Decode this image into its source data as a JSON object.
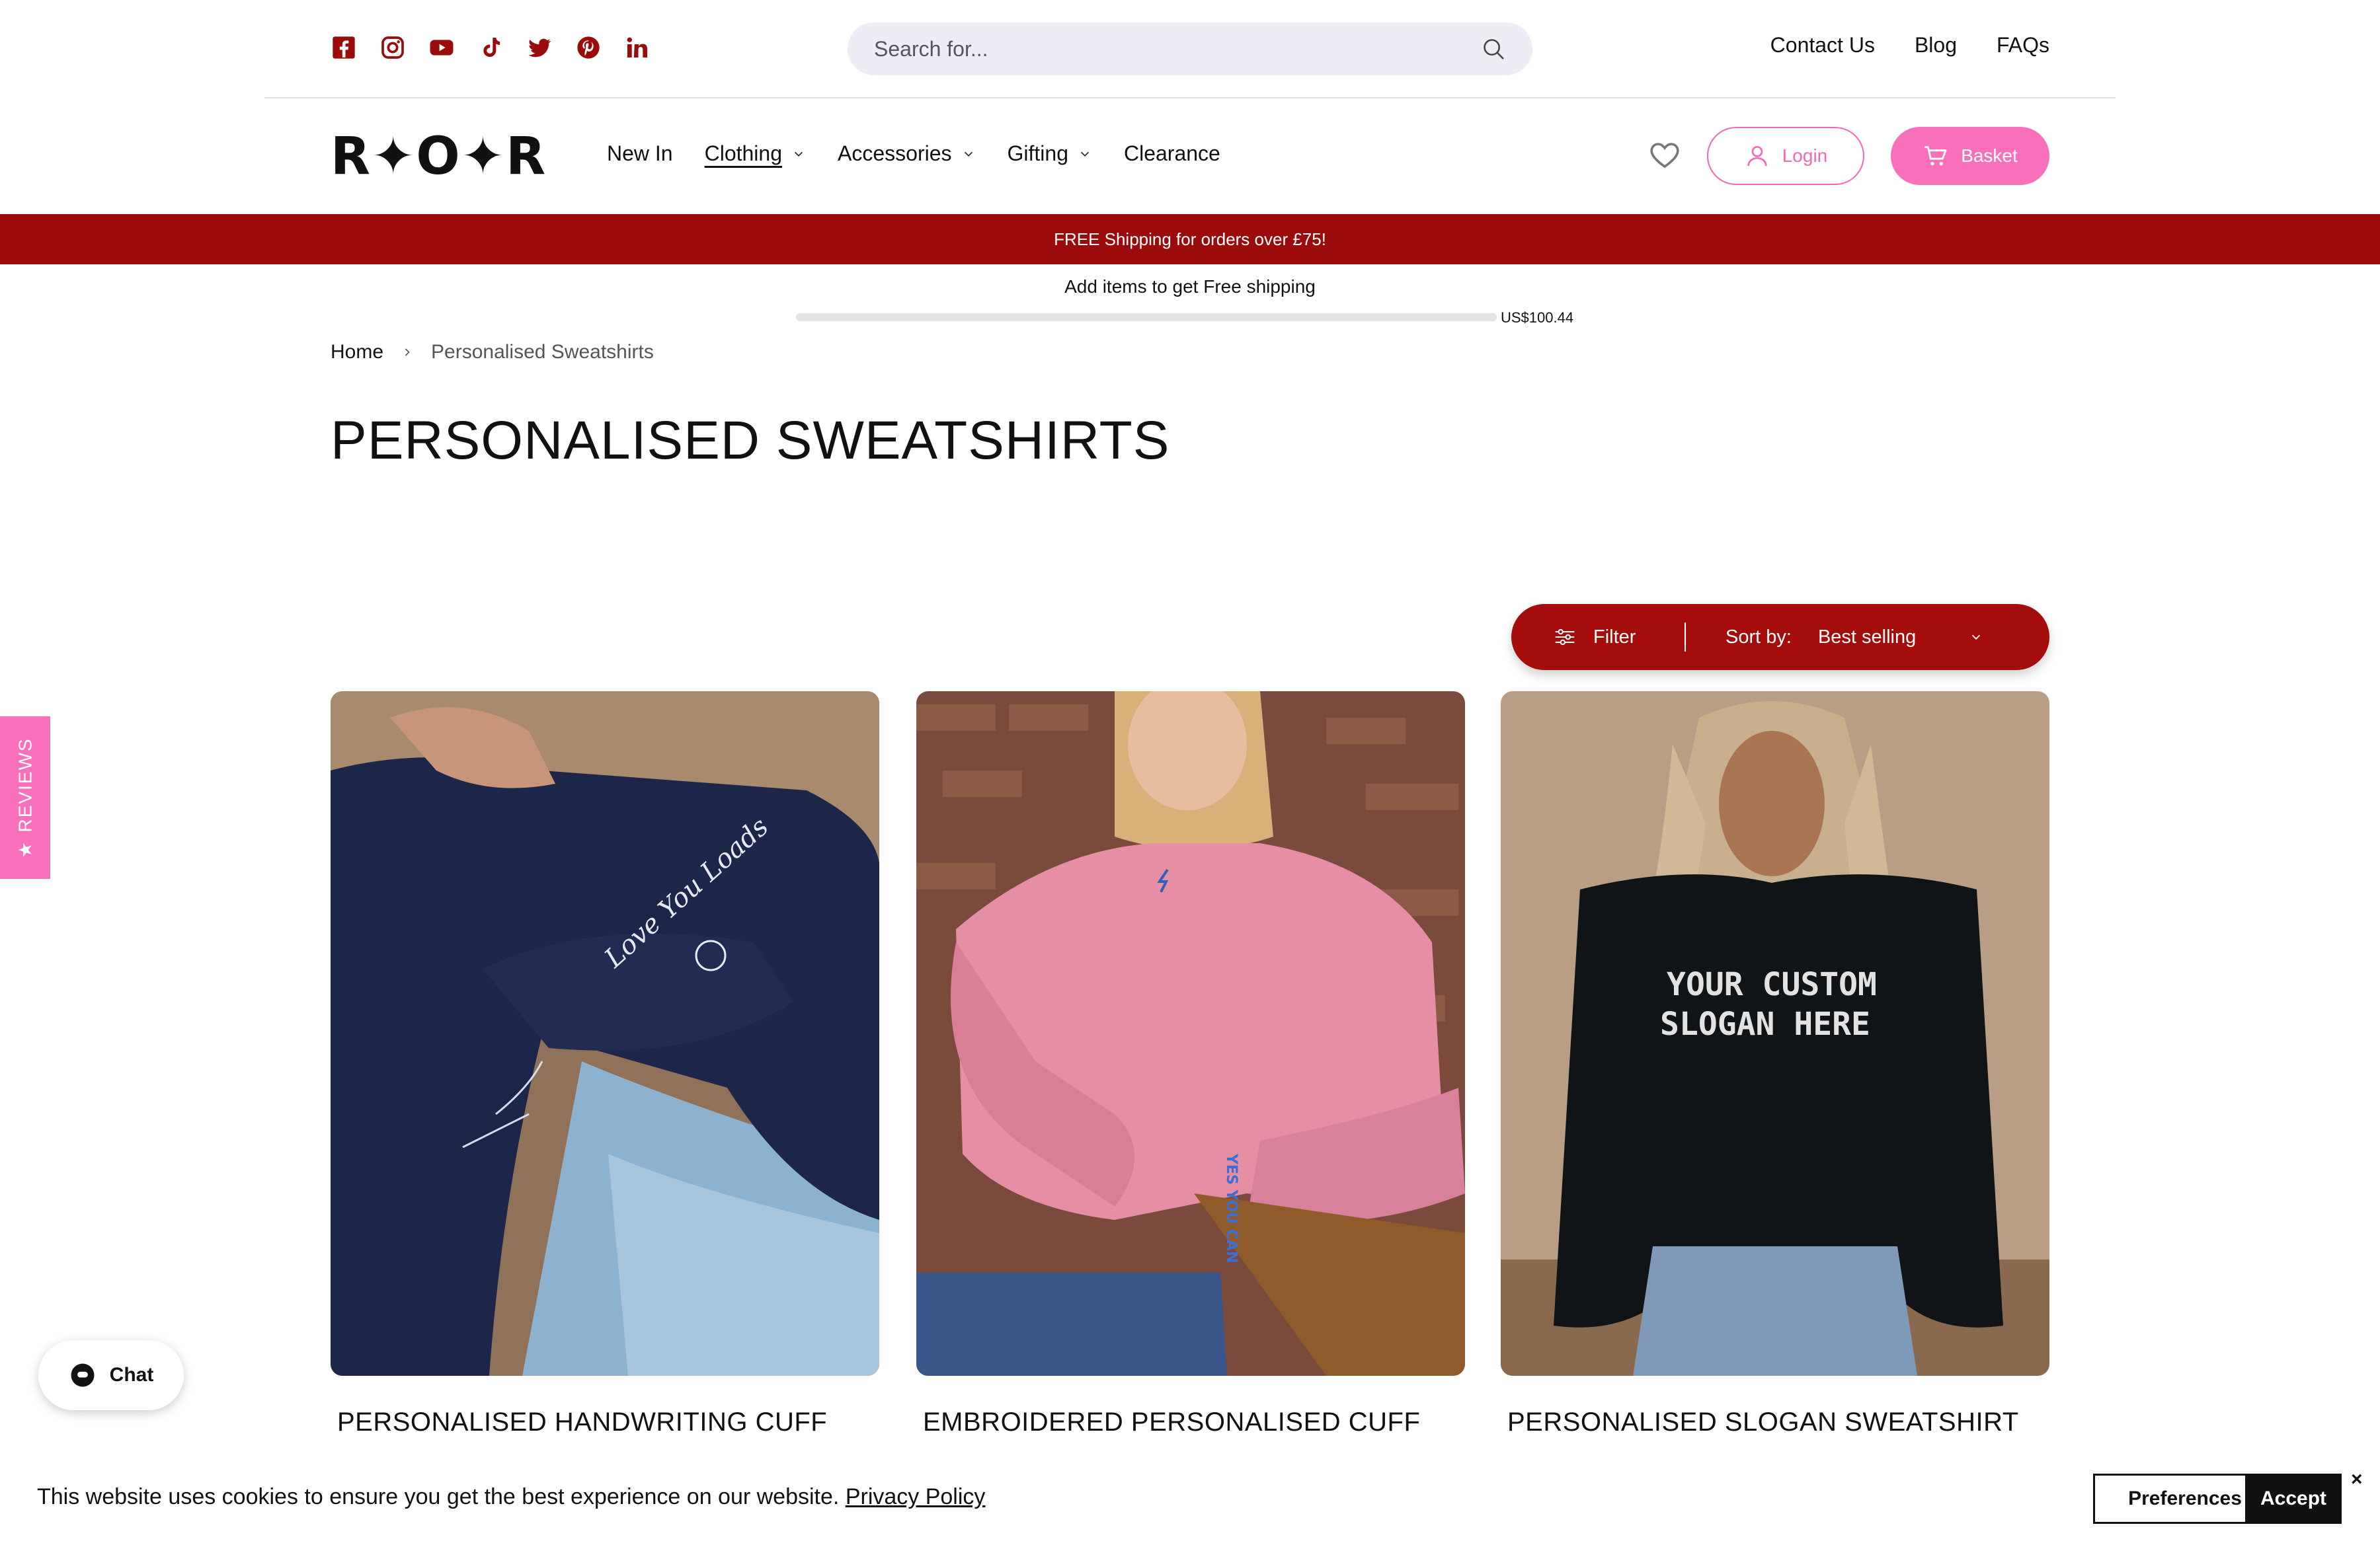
{
  "search": {
    "placeholder": "Search for..."
  },
  "top_links": [
    "Contact Us",
    "Blog",
    "FAQs"
  ],
  "social_icons": [
    "facebook-icon",
    "instagram-icon",
    "youtube-icon",
    "tiktok-icon",
    "twitter-icon",
    "pinterest-icon",
    "linkedin-icon"
  ],
  "brand": {
    "logo_text": "R✦O✦R",
    "accent": "#9b0b0b",
    "pink": "#f86fba"
  },
  "nav": {
    "items": [
      {
        "label": "New In",
        "dropdown": false
      },
      {
        "label": "Clothing",
        "dropdown": true,
        "active": true
      },
      {
        "label": "Accessories",
        "dropdown": true
      },
      {
        "label": "Gifting",
        "dropdown": true
      },
      {
        "label": "Clearance",
        "dropdown": false
      }
    ],
    "login_label": "Login",
    "basket_label": "Basket"
  },
  "banner": {
    "text": "FREE Shipping for orders over £75!"
  },
  "shipping": {
    "text": "Add items to get Free shipping",
    "amount": "US$100.44",
    "progress": 0
  },
  "breadcrumb": {
    "home": "Home",
    "current": "Personalised Sweatshirts"
  },
  "page": {
    "title": "PERSONALISED SWEATSHIRTS"
  },
  "filter": {
    "filter_label": "Filter",
    "sort_label": "Sort by:",
    "sort_value": "Best selling"
  },
  "products": [
    {
      "name": "PERSONALISED HANDWRITING CUFF"
    },
    {
      "name": "EMBROIDERED PERSONALISED CUFF"
    },
    {
      "name": "PERSONALISED SLOGAN SWEATSHIRT"
    }
  ],
  "product_image_text": {
    "p1_main": "Love You Loads",
    "p2_cuff": "YES YOU CAN",
    "p3_slogan_1": "YOUR CUSTOM",
    "p3_slogan_2": "SLOGAN HERE"
  },
  "reviews_tab": {
    "label": "REVIEWS"
  },
  "chat": {
    "label": "Chat"
  },
  "cookie": {
    "message": "This website uses cookies to ensure you get the best experience on our website.",
    "link": "Privacy Policy",
    "preferences": "Preferences",
    "accept": "Accept",
    "close": "×"
  }
}
